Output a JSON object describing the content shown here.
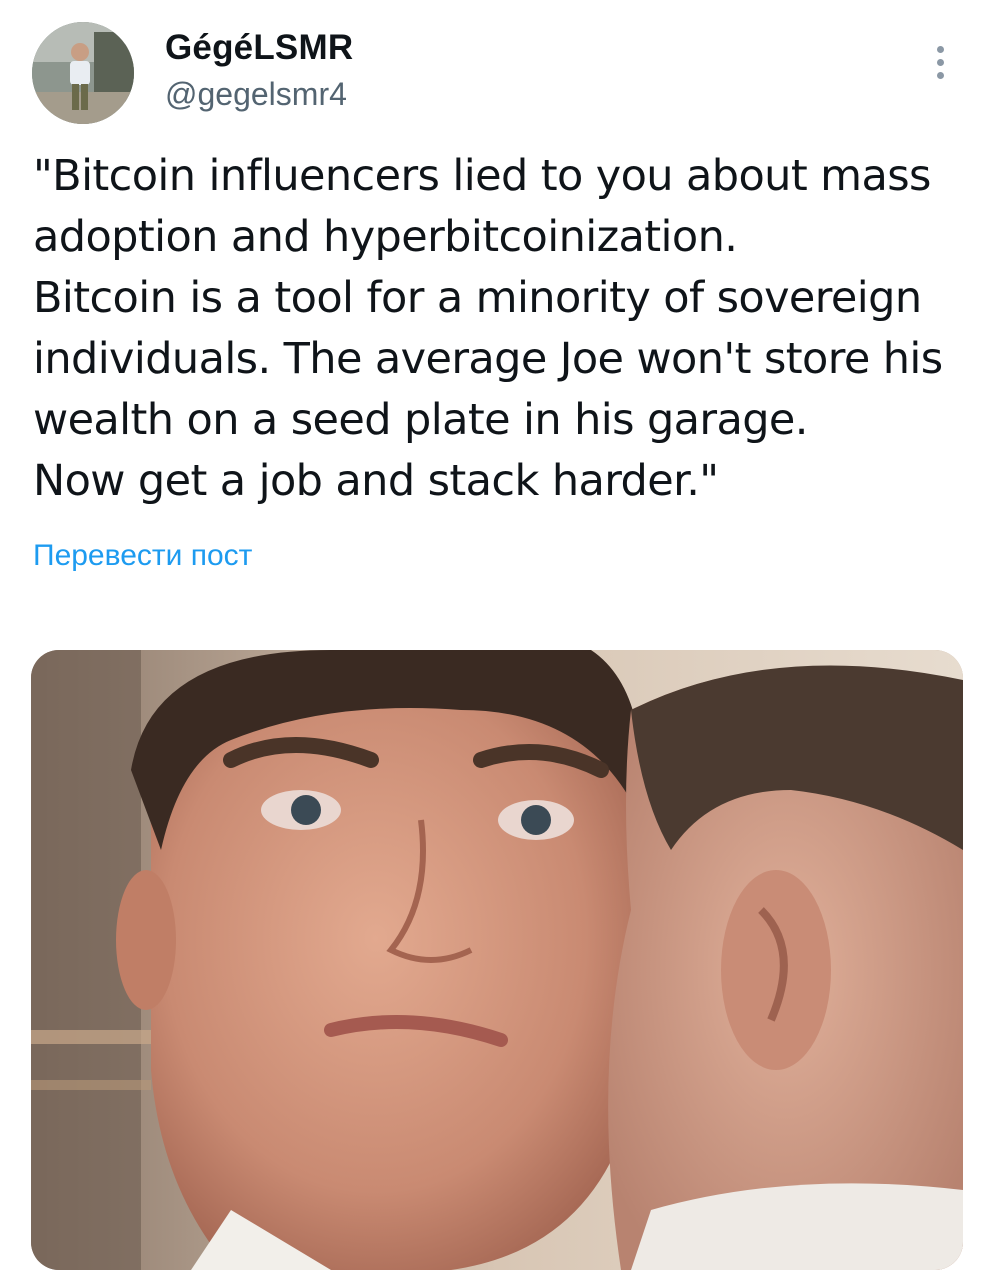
{
  "author": {
    "display_name": "GégéLSMR",
    "handle": "@gegelsmr4",
    "avatar_icon": "user-avatar"
  },
  "menu": {
    "more_icon": "more-vertical-icon"
  },
  "tweet": {
    "lines": [
      "\"Bitcoin influencers lied to you about mass",
      "adoption and hyperbitcoinization.",
      "Bitcoin is a tool for a minority of sovereign",
      "individuals. The average Joe won't store his",
      "wealth on a seed plate in his garage.",
      "Now get a job and stack harder.\""
    ],
    "translate_label": "Перевести пост"
  },
  "colors": {
    "link": "#1d9bf0",
    "handle": "#536471",
    "text": "#0f1419"
  }
}
